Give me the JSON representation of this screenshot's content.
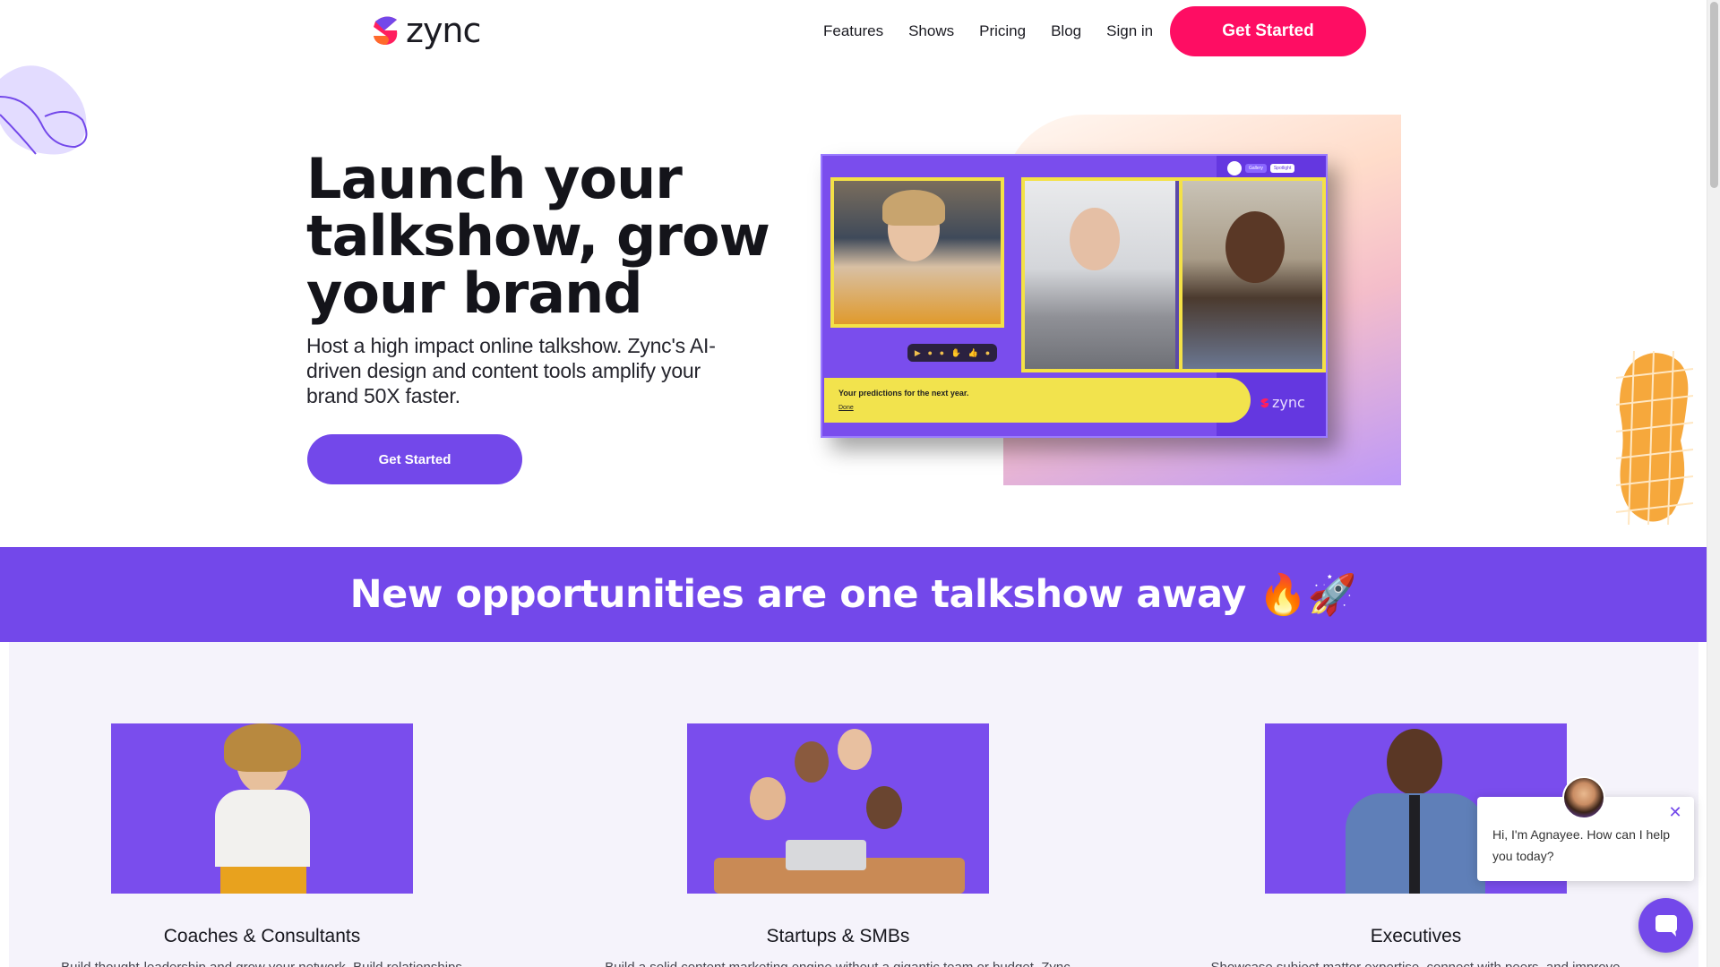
{
  "brand": {
    "name": "zync",
    "accent": "#7348ea",
    "cta_color": "#fe0d63"
  },
  "nav": {
    "items": [
      {
        "label": "Features"
      },
      {
        "label": "Shows"
      },
      {
        "label": "Pricing"
      },
      {
        "label": "Blog"
      },
      {
        "label": "Sign in"
      }
    ],
    "cta_label": "Get Started"
  },
  "hero": {
    "title": "Launch your talkshow, grow your brand",
    "subtitle": "Host a high impact online talkshow. Zync's AI-driven design and content tools amplify your brand 50X faster.",
    "cta_label": "Get Started",
    "preview": {
      "gallery_label": "Gallery",
      "spotlight_label": "Spotlight",
      "banner_text": "Your predictions for the next year.",
      "banner_link": "Done",
      "logo_text": "zync"
    }
  },
  "band": {
    "text": "New opportunities are one talkshow away",
    "emoji": "🔥🚀"
  },
  "audience": {
    "cards": [
      {
        "title": "Coaches & Consultants",
        "desc": "Build thought-leadership and grow your network. Build relationships"
      },
      {
        "title": "Startups & SMBs",
        "desc": "Build a solid content marketing engine without a gigantic team or budget. Zync"
      },
      {
        "title": "Executives",
        "desc": "Showcase subject matter expertise, connect with peers, and improve"
      }
    ]
  },
  "chat": {
    "message": "Hi, I'm Agnayee. How can I help you today?",
    "close_icon": "close-icon",
    "launcher_icon": "chat-icon"
  }
}
